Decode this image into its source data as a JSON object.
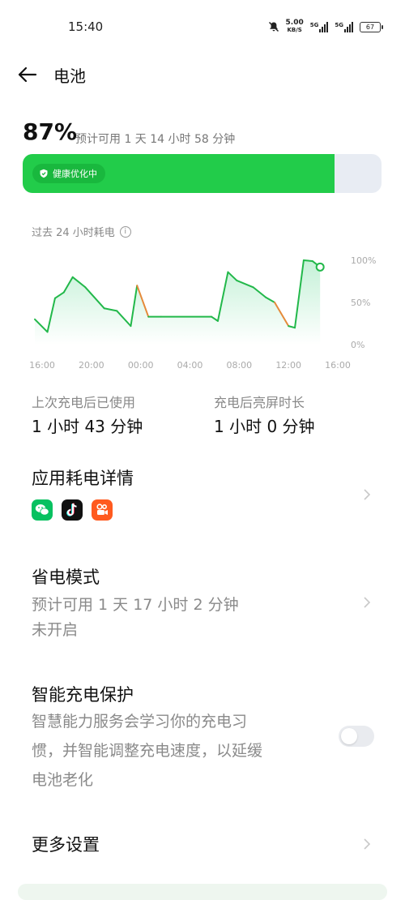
{
  "status_bar": {
    "time": "15:40",
    "net_speed_value": "5.00",
    "net_speed_unit": "KB/S",
    "sim1_label": "5G",
    "sim2_label": "5G",
    "battery_level": "67",
    "icons": [
      "mute-icon",
      "signal-icon",
      "signal-icon",
      "battery-icon"
    ]
  },
  "header": {
    "title": "电池",
    "back_icon": "back-arrow-icon"
  },
  "battery": {
    "percent_text": "87%",
    "percent_value": 87,
    "estimate": "预计可用 1 天 14 小时 58 分钟",
    "badge_label": "健康优化中",
    "fill_color": "#22cc4a"
  },
  "usage_chart": {
    "title": "过去 24 小时耗电",
    "info_icon": "info-icon"
  },
  "chart_data": {
    "type": "line",
    "x_ticks": [
      "16:00",
      "20:00",
      "00:00",
      "04:00",
      "08:00",
      "12:00",
      "16:00"
    ],
    "y_ticks": [
      "100%",
      "50%",
      "0%"
    ],
    "ylim": [
      0,
      100
    ],
    "x_range_hours": [
      0,
      24
    ],
    "series": [
      {
        "points": [
          [
            0,
            30
          ],
          [
            1,
            15
          ],
          [
            1.6,
            55
          ],
          [
            2.3,
            62
          ],
          [
            3,
            80
          ],
          [
            4,
            68
          ],
          [
            5.5,
            43
          ],
          [
            6.5,
            40
          ],
          [
            7.6,
            22
          ],
          [
            8.1,
            70
          ],
          [
            9,
            33
          ],
          [
            10,
            33
          ],
          [
            14,
            33
          ],
          [
            14.5,
            28
          ],
          [
            15.3,
            86
          ],
          [
            16,
            76
          ],
          [
            17.3,
            68
          ],
          [
            18.3,
            56
          ],
          [
            19,
            50
          ],
          [
            20.1,
            22
          ],
          [
            20.6,
            20
          ],
          [
            21.3,
            100
          ],
          [
            22,
            99
          ],
          [
            22.6,
            92
          ]
        ]
      }
    ],
    "charging_color": "#22b84a",
    "discharge_highlight_color": "#e58a3a",
    "grid": false,
    "legend": "none"
  },
  "stats": {
    "used_label": "上次充电后已使用",
    "used_value": "1 小时 43 分钟",
    "screen_label": "充电后亮屏时长",
    "screen_value": "1 小时 0 分钟"
  },
  "app_usage": {
    "title": "应用耗电详情",
    "apps": [
      {
        "icon": "wechat-icon",
        "color": "#07c160"
      },
      {
        "icon": "tiktok-icon",
        "color": "#111111"
      },
      {
        "icon": "kuaishou-icon",
        "color": "#ff5a1f"
      }
    ]
  },
  "power_saving": {
    "title": "省电模式",
    "estimate": "预计可用 1 天 17 小时 2 分钟",
    "state": "未开启"
  },
  "smart_charge": {
    "title": "智能充电保护",
    "desc_line1": "智慧能力服务会学习你的充电习",
    "desc_line2": "惯，并智能调整充电速度，以延缓",
    "desc_line3": "电池老化",
    "enabled": false
  },
  "more_settings": {
    "title": "更多设置"
  }
}
